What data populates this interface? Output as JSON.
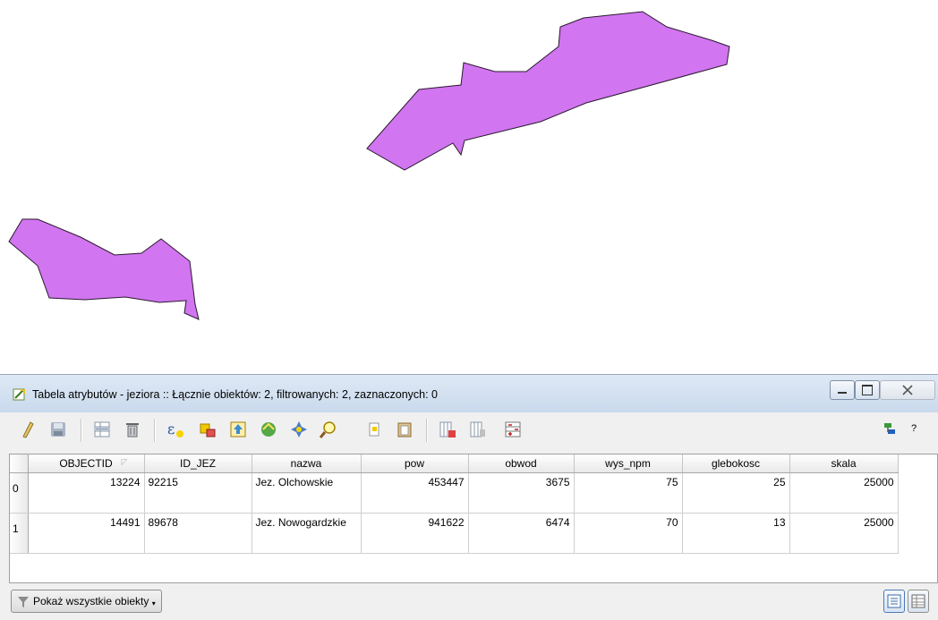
{
  "window": {
    "title": "Tabela atrybutów - jeziora :: Łącznie obiektów: 2, filtrowanych: 2, zaznaczonych: 0",
    "help_label": "?"
  },
  "toolbar": {
    "icons": [
      "pencil-icon",
      "save-icon",
      "delete-selected-icon",
      "trash-icon",
      "expression-select-icon",
      "select-all-icon",
      "invert-selection-icon",
      "move-to-top-icon",
      "pan-to-selected-icon",
      "zoom-to-selected-icon",
      "copy-icon",
      "paste-icon",
      "delete-column-icon",
      "add-column-icon",
      "field-calculator-icon"
    ]
  },
  "table": {
    "columns": [
      "OBJECTID",
      "ID_JEZ",
      "nazwa",
      "pow",
      "obwod",
      "wys_npm",
      "glebokosc",
      "skala"
    ],
    "rows": [
      {
        "header": "0",
        "cells": [
          "13224",
          "92215",
          "Jez. Olchowskie",
          "453447",
          "3675",
          "75",
          "25",
          "25000"
        ]
      },
      {
        "header": "1",
        "cells": [
          "14491",
          "89678",
          "Jez. Nowogardzkie",
          "941622",
          "6474",
          "70",
          "13",
          "25000"
        ]
      }
    ]
  },
  "footer": {
    "filter_label": "Pokaż wszystkie obiekty"
  },
  "colors": {
    "polygon_fill": "#d175f0",
    "polygon_stroke": "#2a1a2e"
  }
}
